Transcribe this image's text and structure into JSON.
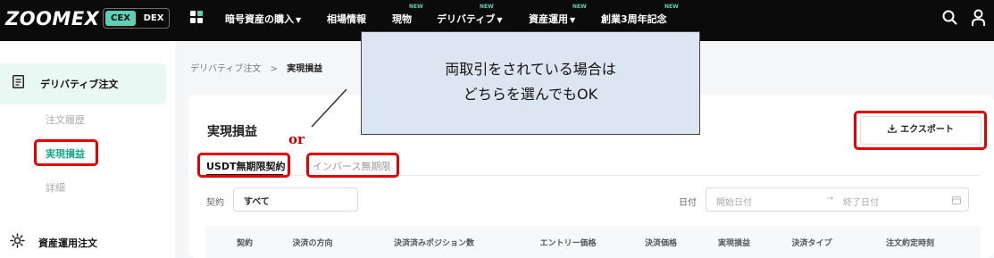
{
  "header": {
    "logo": "ZOOMEX",
    "mode": {
      "cex": "CEX",
      "dex": "DEX"
    },
    "nav": [
      {
        "label": "暗号資産の購入",
        "caret": true,
        "new": false
      },
      {
        "label": "相場情報",
        "caret": false,
        "new": false
      },
      {
        "label": "現物",
        "caret": false,
        "new": true
      },
      {
        "label": "デリバティブ",
        "caret": true,
        "new": true
      },
      {
        "label": "資産運用",
        "caret": true,
        "new": true
      },
      {
        "label": "創業3周年記念",
        "caret": false,
        "new": true
      }
    ],
    "new_badge": "NEW"
  },
  "sidebar": {
    "section_derivatives": "デリバティブ注文",
    "items": [
      "注文履歴",
      "実現損益",
      "詳細"
    ],
    "current_item": "実現損益",
    "section_earn": "資産運用注文"
  },
  "breadcrumb": {
    "parent": "デリバティブ注文",
    "separator": ">",
    "current": "実現損益"
  },
  "main": {
    "title": "実現損益",
    "export_label": "エクスポート",
    "tabs": [
      {
        "label": "USDT無期限契約",
        "active": true
      },
      {
        "label": "インバース無期限",
        "active": false
      }
    ],
    "filters": {
      "contract_label": "契約",
      "contract_value": "すべて",
      "date_label": "日付",
      "start_placeholder": "開始日付",
      "end_placeholder": "終了日付",
      "date_separator": "→"
    },
    "table_headers": [
      "契約",
      "決済の方向",
      "決済済みポジション数",
      "エントリー価格",
      "決済価格",
      "実現損益",
      "決済タイプ",
      "注文約定時刻"
    ]
  },
  "annotation": {
    "callout_lines": [
      "両取引をされている場合は",
      "どちらを選んでもOK"
    ],
    "or_label": "or"
  },
  "colors": {
    "accent": "#5fd0b4",
    "active_text": "#17a98a",
    "highlight": "#e60000",
    "callout_bg": "#dce6f2",
    "topbar": "#0b0b0b"
  }
}
